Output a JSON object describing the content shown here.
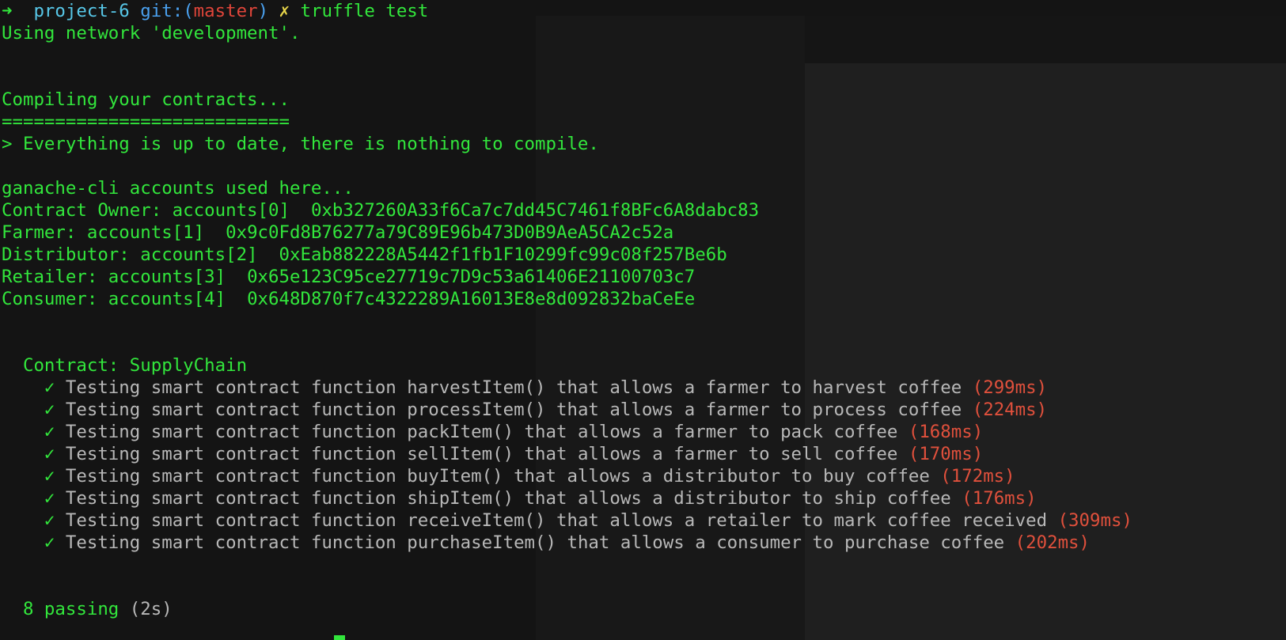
{
  "prompt": {
    "arrow": "➜",
    "dir": "project-6",
    "git_prefix": "git:",
    "paren_open": "(",
    "branch": "master",
    "paren_close": ")",
    "dirty_mark": "✗",
    "command": "truffle test"
  },
  "network_line": "Using network 'development'.",
  "compile": {
    "heading": "Compiling your contracts...",
    "rule": "===========================",
    "message": "> Everything is up to date, there is nothing to compile."
  },
  "accounts": {
    "heading": "ganache-cli accounts used here...",
    "rows": [
      {
        "label": "Contract Owner: accounts[0]",
        "address": "0xb327260A33f6Ca7c7dd45C7461f8BFc6A8dabc83"
      },
      {
        "label": "Farmer: accounts[1]",
        "address": "0x9c0Fd8B76277a79C89E96b473D0B9AeA5CA2c52a"
      },
      {
        "label": "Distributor: accounts[2]",
        "address": "0xEab882228A5442f1fb1F10299fc99c08f257Be6b"
      },
      {
        "label": "Retailer: accounts[3]",
        "address": "0x65e123C95ce27719c7D9c53a61406E21100703c7"
      },
      {
        "label": "Consumer: accounts[4]",
        "address": "0x648D870f7c4322289A16013E8e8d092832baCeEe"
      }
    ]
  },
  "suite": {
    "title": "Contract: SupplyChain",
    "check": "✓",
    "tests": [
      {
        "text": "Testing smart contract function harvestItem() that allows a farmer to harvest coffee",
        "time": "(299ms)"
      },
      {
        "text": "Testing smart contract function processItem() that allows a farmer to process coffee",
        "time": "(224ms)"
      },
      {
        "text": "Testing smart contract function packItem() that allows a farmer to pack coffee",
        "time": "(168ms)"
      },
      {
        "text": "Testing smart contract function sellItem() that allows a farmer to sell coffee",
        "time": "(170ms)"
      },
      {
        "text": "Testing smart contract function buyItem() that allows a distributor to buy coffee",
        "time": "(172ms)"
      },
      {
        "text": "Testing smart contract function shipItem() that allows a distributor to ship coffee",
        "time": "(176ms)"
      },
      {
        "text": "Testing smart contract function receiveItem() that allows a retailer to mark coffee received",
        "time": "(309ms)"
      },
      {
        "text": "Testing smart contract function purchaseItem() that allows a consumer to purchase coffee",
        "time": "(202ms)"
      }
    ]
  },
  "summary": {
    "passing": "8 passing",
    "duration": "(2s)"
  },
  "colors": {
    "output_green": "#32e63c",
    "dir_cyan": "#57c7e8",
    "branch_red": "#e0453a",
    "dirty_yellow": "#e8d64a",
    "test_gray": "#b8b8b8",
    "time_red": "#e0503c",
    "background": "#141414"
  }
}
